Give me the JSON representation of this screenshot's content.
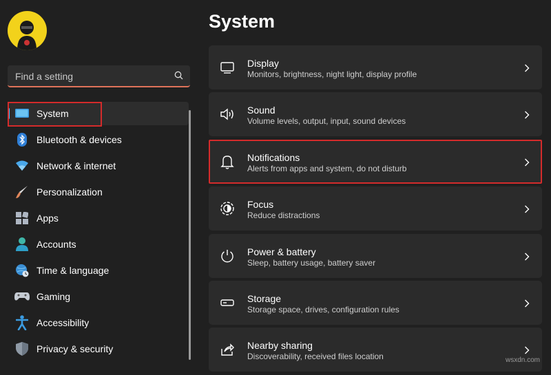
{
  "sidebar": {
    "search": {
      "placeholder": "Find a setting"
    },
    "items": [
      {
        "label": "System",
        "active": true
      },
      {
        "label": "Bluetooth & devices"
      },
      {
        "label": "Network & internet"
      },
      {
        "label": "Personalization"
      },
      {
        "label": "Apps"
      },
      {
        "label": "Accounts"
      },
      {
        "label": "Time & language"
      },
      {
        "label": "Gaming"
      },
      {
        "label": "Accessibility"
      },
      {
        "label": "Privacy & security"
      }
    ]
  },
  "main": {
    "title": "System",
    "cards": [
      {
        "title": "Display",
        "subtitle": "Monitors, brightness, night light, display profile"
      },
      {
        "title": "Sound",
        "subtitle": "Volume levels, output, input, sound devices"
      },
      {
        "title": "Notifications",
        "subtitle": "Alerts from apps and system, do not disturb",
        "selected": true
      },
      {
        "title": "Focus",
        "subtitle": "Reduce distractions"
      },
      {
        "title": "Power & battery",
        "subtitle": "Sleep, battery usage, battery saver"
      },
      {
        "title": "Storage",
        "subtitle": "Storage space, drives, configuration rules"
      },
      {
        "title": "Nearby sharing",
        "subtitle": "Discoverability, received files location"
      }
    ]
  },
  "watermark": "wsxdn.com",
  "colors": {
    "accent": "#4cc2ff",
    "highlight": "#d42b2b",
    "search_underline": "#e0735a"
  }
}
